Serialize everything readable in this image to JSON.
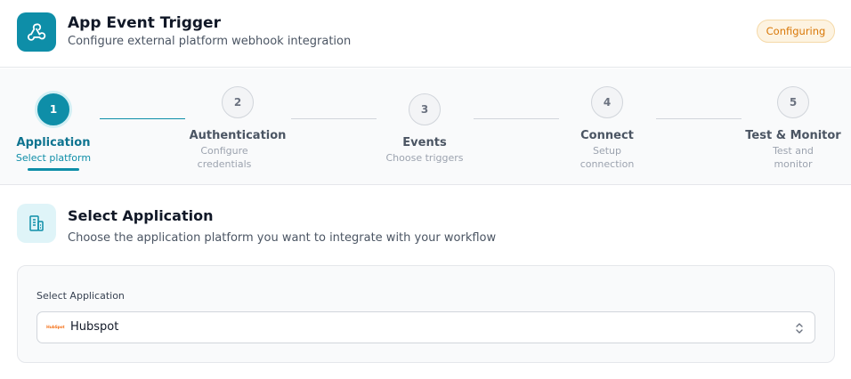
{
  "header": {
    "title": "App Event Trigger",
    "subtitle": "Configure external platform webhook integration",
    "status": "Configuring",
    "icon": "webhook-icon",
    "accent_color": "#0e8ea8",
    "status_color": "#d97706"
  },
  "steps": [
    {
      "number": "1",
      "label": "Application",
      "sub": "Select platform",
      "state": "active"
    },
    {
      "number": "2",
      "label": "Authentication",
      "sub": "Configure credentials",
      "state": "pending"
    },
    {
      "number": "3",
      "label": "Events",
      "sub": "Choose triggers",
      "state": "pending"
    },
    {
      "number": "4",
      "label": "Connect",
      "sub": "Setup connection",
      "state": "pending"
    },
    {
      "number": "5",
      "label": "Test & Monitor",
      "sub": "Test and monitor",
      "state": "pending"
    }
  ],
  "section": {
    "title": "Select Application",
    "description": "Choose the application platform you want to integrate with your workflow",
    "icon": "building-icon"
  },
  "form": {
    "label": "Select Application",
    "selected_value": "Hubspot",
    "selected_logo_text": "HubSpot",
    "selected_icon": "hubspot-logo",
    "control_icon": "chevron-up-down-icon"
  }
}
